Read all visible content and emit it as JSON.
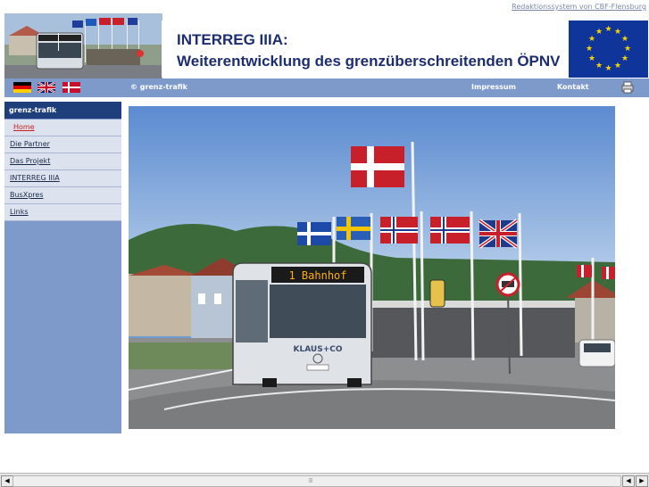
{
  "header": {
    "top_link": "Redaktionssystem von CBF-Flensburg",
    "title_line1": "INTERREG IIIA:",
    "title_line2": "Weiterentwicklung des grenzüberschreitenden ÖPNV",
    "bus_sign": "1 Bahnhof",
    "bus_brand": "KLAUS+CO"
  },
  "navbar": {
    "copyright": "© grenz-trafik",
    "impressum": "Impressum",
    "kontakt": "Kontakt",
    "languages": [
      "de",
      "en",
      "da"
    ]
  },
  "sidebar": {
    "heading": "grenz-trafik",
    "items": [
      {
        "label": "Home",
        "active": true
      },
      {
        "label": "Die Partner",
        "active": false
      },
      {
        "label": "Das Projekt",
        "active": false
      },
      {
        "label": "INTERREG IIIA",
        "active": false
      },
      {
        "label": "BusXpres",
        "active": false
      },
      {
        "label": "Links",
        "active": false
      }
    ]
  },
  "main": {
    "photo_sign": "1 Bahnhof",
    "photo_bus_brand": "KLAUS+CO"
  },
  "icons": {
    "print": "printer-icon",
    "scroll_left": "arrow-left-icon",
    "scroll_right": "arrow-right-icon"
  },
  "colors": {
    "nav_blue": "#7e9acb",
    "sidebar_head": "#1f3e7c",
    "title_blue": "#1c2d70",
    "eu_blue": "#10359a",
    "active_red": "#c62020"
  }
}
